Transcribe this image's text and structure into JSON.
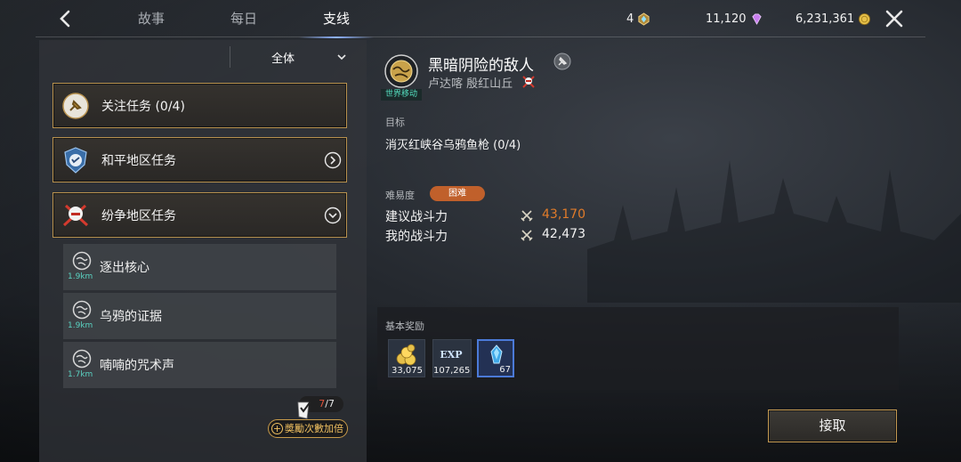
{
  "header": {
    "tabs": [
      {
        "label": "故事",
        "active": false
      },
      {
        "label": "每日",
        "active": false
      },
      {
        "label": "支线",
        "active": true
      }
    ],
    "currencies": [
      {
        "value": "4",
        "icon": "crystal-token-icon",
        "color": "#d9b35a"
      },
      {
        "value": "11,120",
        "icon": "purple-gem-icon",
        "color": "#c97ef0"
      },
      {
        "value": "6,231,361",
        "icon": "gold-coin-icon",
        "color": "#e6c04a"
      }
    ]
  },
  "sidebar": {
    "filter_label": "全体",
    "categories": [
      {
        "label": "关注任务 (0/4)",
        "icon": "bookmark-pin-icon"
      },
      {
        "label": "和平地区任务",
        "icon": "peace-shield-icon",
        "arrow": "chevron-right"
      },
      {
        "label": "纷争地区任务",
        "icon": "crossed-swords-icon",
        "arrow": "chevron-down"
      }
    ],
    "quests": [
      {
        "label": "逐出核心",
        "distance": "1.9km"
      },
      {
        "label": "乌鸦的证据",
        "distance": "1.9km"
      },
      {
        "label": "喃喃的咒术声",
        "distance": "1.7km"
      }
    ],
    "count_current": "7",
    "count_total": "/7",
    "bonus_label": "奬勵次數加倍"
  },
  "detail": {
    "title": "黑暗阴险的敌人",
    "icon_tag": "世界移动",
    "location": "卢达喀 殷红山丘",
    "objective_label": "目标",
    "objective": "消灭红峡谷乌鸦鱼枪   (0/4)",
    "difficulty_label": "难易度",
    "difficulty": "困难",
    "recommended_power_label": "建议战斗力",
    "recommended_power": "43,170",
    "my_power_label": "我的战斗力",
    "my_power": "42,473",
    "recommended_color": "#e07b2a",
    "rewards_label": "基本奖励",
    "rewards": [
      {
        "icon": "gold-pile-icon",
        "qty": "33,075"
      },
      {
        "icon": "exp-icon",
        "icon_text": "EXP",
        "qty": "107,265"
      },
      {
        "icon": "blue-crystal-icon",
        "qty": "67"
      }
    ],
    "accept_label": "接取"
  }
}
